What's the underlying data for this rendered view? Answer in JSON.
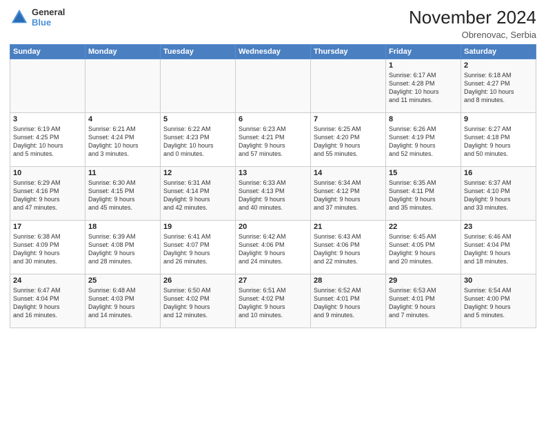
{
  "header": {
    "logo_line1": "General",
    "logo_line2": "Blue",
    "month_year": "November 2024",
    "location": "Obrenovac, Serbia"
  },
  "days_of_week": [
    "Sunday",
    "Monday",
    "Tuesday",
    "Wednesday",
    "Thursday",
    "Friday",
    "Saturday"
  ],
  "weeks": [
    [
      {
        "day": "",
        "content": ""
      },
      {
        "day": "",
        "content": ""
      },
      {
        "day": "",
        "content": ""
      },
      {
        "day": "",
        "content": ""
      },
      {
        "day": "",
        "content": ""
      },
      {
        "day": "1",
        "content": "Sunrise: 6:17 AM\nSunset: 4:28 PM\nDaylight: 10 hours\nand 11 minutes."
      },
      {
        "day": "2",
        "content": "Sunrise: 6:18 AM\nSunset: 4:27 PM\nDaylight: 10 hours\nand 8 minutes."
      }
    ],
    [
      {
        "day": "3",
        "content": "Sunrise: 6:19 AM\nSunset: 4:25 PM\nDaylight: 10 hours\nand 5 minutes."
      },
      {
        "day": "4",
        "content": "Sunrise: 6:21 AM\nSunset: 4:24 PM\nDaylight: 10 hours\nand 3 minutes."
      },
      {
        "day": "5",
        "content": "Sunrise: 6:22 AM\nSunset: 4:23 PM\nDaylight: 10 hours\nand 0 minutes."
      },
      {
        "day": "6",
        "content": "Sunrise: 6:23 AM\nSunset: 4:21 PM\nDaylight: 9 hours\nand 57 minutes."
      },
      {
        "day": "7",
        "content": "Sunrise: 6:25 AM\nSunset: 4:20 PM\nDaylight: 9 hours\nand 55 minutes."
      },
      {
        "day": "8",
        "content": "Sunrise: 6:26 AM\nSunset: 4:19 PM\nDaylight: 9 hours\nand 52 minutes."
      },
      {
        "day": "9",
        "content": "Sunrise: 6:27 AM\nSunset: 4:18 PM\nDaylight: 9 hours\nand 50 minutes."
      }
    ],
    [
      {
        "day": "10",
        "content": "Sunrise: 6:29 AM\nSunset: 4:16 PM\nDaylight: 9 hours\nand 47 minutes."
      },
      {
        "day": "11",
        "content": "Sunrise: 6:30 AM\nSunset: 4:15 PM\nDaylight: 9 hours\nand 45 minutes."
      },
      {
        "day": "12",
        "content": "Sunrise: 6:31 AM\nSunset: 4:14 PM\nDaylight: 9 hours\nand 42 minutes."
      },
      {
        "day": "13",
        "content": "Sunrise: 6:33 AM\nSunset: 4:13 PM\nDaylight: 9 hours\nand 40 minutes."
      },
      {
        "day": "14",
        "content": "Sunrise: 6:34 AM\nSunset: 4:12 PM\nDaylight: 9 hours\nand 37 minutes."
      },
      {
        "day": "15",
        "content": "Sunrise: 6:35 AM\nSunset: 4:11 PM\nDaylight: 9 hours\nand 35 minutes."
      },
      {
        "day": "16",
        "content": "Sunrise: 6:37 AM\nSunset: 4:10 PM\nDaylight: 9 hours\nand 33 minutes."
      }
    ],
    [
      {
        "day": "17",
        "content": "Sunrise: 6:38 AM\nSunset: 4:09 PM\nDaylight: 9 hours\nand 30 minutes."
      },
      {
        "day": "18",
        "content": "Sunrise: 6:39 AM\nSunset: 4:08 PM\nDaylight: 9 hours\nand 28 minutes."
      },
      {
        "day": "19",
        "content": "Sunrise: 6:41 AM\nSunset: 4:07 PM\nDaylight: 9 hours\nand 26 minutes."
      },
      {
        "day": "20",
        "content": "Sunrise: 6:42 AM\nSunset: 4:06 PM\nDaylight: 9 hours\nand 24 minutes."
      },
      {
        "day": "21",
        "content": "Sunrise: 6:43 AM\nSunset: 4:06 PM\nDaylight: 9 hours\nand 22 minutes."
      },
      {
        "day": "22",
        "content": "Sunrise: 6:45 AM\nSunset: 4:05 PM\nDaylight: 9 hours\nand 20 minutes."
      },
      {
        "day": "23",
        "content": "Sunrise: 6:46 AM\nSunset: 4:04 PM\nDaylight: 9 hours\nand 18 minutes."
      }
    ],
    [
      {
        "day": "24",
        "content": "Sunrise: 6:47 AM\nSunset: 4:04 PM\nDaylight: 9 hours\nand 16 minutes."
      },
      {
        "day": "25",
        "content": "Sunrise: 6:48 AM\nSunset: 4:03 PM\nDaylight: 9 hours\nand 14 minutes."
      },
      {
        "day": "26",
        "content": "Sunrise: 6:50 AM\nSunset: 4:02 PM\nDaylight: 9 hours\nand 12 minutes."
      },
      {
        "day": "27",
        "content": "Sunrise: 6:51 AM\nSunset: 4:02 PM\nDaylight: 9 hours\nand 10 minutes."
      },
      {
        "day": "28",
        "content": "Sunrise: 6:52 AM\nSunset: 4:01 PM\nDaylight: 9 hours\nand 9 minutes."
      },
      {
        "day": "29",
        "content": "Sunrise: 6:53 AM\nSunset: 4:01 PM\nDaylight: 9 hours\nand 7 minutes."
      },
      {
        "day": "30",
        "content": "Sunrise: 6:54 AM\nSunset: 4:00 PM\nDaylight: 9 hours\nand 5 minutes."
      }
    ]
  ]
}
